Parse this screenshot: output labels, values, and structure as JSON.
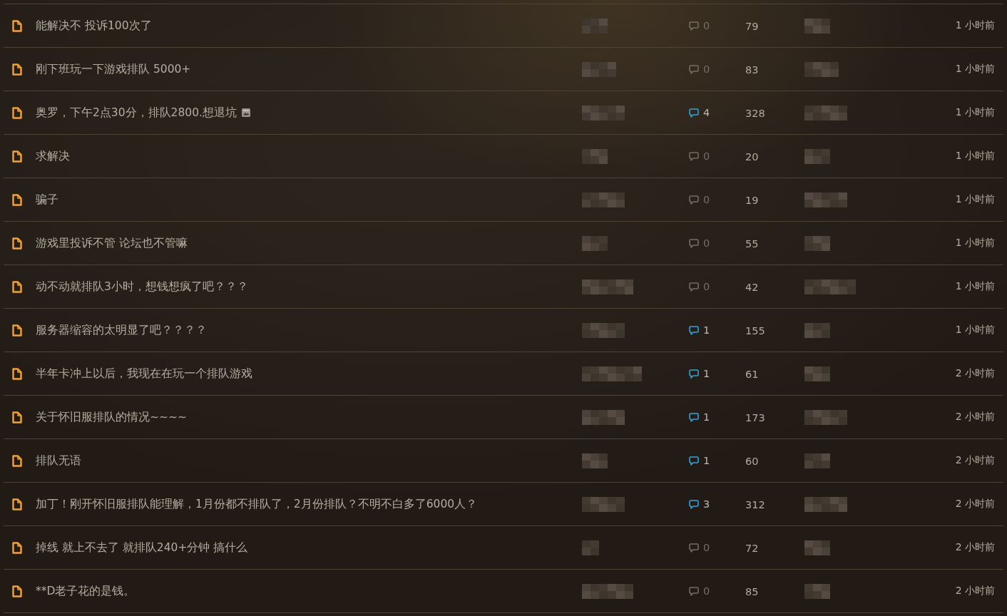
{
  "threads": [
    {
      "title": "能解决不 投诉100次了",
      "has_image": false,
      "replies": "0",
      "replies_highlighted": false,
      "views": "79",
      "time": "1 小时前"
    },
    {
      "title": "刚下班玩一下游戏排队 5000+",
      "has_image": false,
      "replies": "0",
      "replies_highlighted": false,
      "views": "83",
      "time": "1 小时前"
    },
    {
      "title": "奥罗，下午2点30分，排队2800.想退坑",
      "has_image": true,
      "replies": "4",
      "replies_highlighted": true,
      "views": "328",
      "time": "1 小时前"
    },
    {
      "title": "求解决",
      "has_image": false,
      "replies": "0",
      "replies_highlighted": false,
      "views": "20",
      "time": "1 小时前"
    },
    {
      "title": "骗子",
      "has_image": false,
      "replies": "0",
      "replies_highlighted": false,
      "views": "19",
      "time": "1 小时前"
    },
    {
      "title": "游戏里投诉不管 论坛也不管嘛",
      "has_image": false,
      "replies": "0",
      "replies_highlighted": false,
      "views": "55",
      "time": "1 小时前"
    },
    {
      "title": "动不动就排队3小时，想钱想疯了吧？？？",
      "has_image": false,
      "replies": "0",
      "replies_highlighted": false,
      "views": "42",
      "time": "1 小时前"
    },
    {
      "title": "服务器缩容的太明显了吧？？？？",
      "has_image": false,
      "replies": "1",
      "replies_highlighted": true,
      "views": "155",
      "time": "1 小时前"
    },
    {
      "title": "半年卡冲上以后，我现在在玩一个排队游戏",
      "has_image": false,
      "replies": "1",
      "replies_highlighted": true,
      "views": "61",
      "time": "2 小时前"
    },
    {
      "title": "关于怀旧服排队的情况~~~~",
      "has_image": false,
      "replies": "1",
      "replies_highlighted": true,
      "views": "173",
      "time": "2 小时前"
    },
    {
      "title": "排队无语",
      "has_image": false,
      "replies": "1",
      "replies_highlighted": true,
      "views": "60",
      "time": "2 小时前"
    },
    {
      "title": "加丁！刚开怀旧服排队能理解，1月份都不排队了，2月份排队？不明不白多了6000人？",
      "has_image": false,
      "replies": "3",
      "replies_highlighted": true,
      "views": "312",
      "time": "2 小时前"
    },
    {
      "title": "掉线 就上不去了 就排队240+分钟 搞什么",
      "has_image": false,
      "replies": "0",
      "replies_highlighted": false,
      "views": "72",
      "time": "2 小时前"
    },
    {
      "title": "**D老子花的是钱。",
      "has_image": false,
      "replies": "0",
      "replies_highlighted": false,
      "views": "85",
      "time": "2 小时前"
    }
  ]
}
